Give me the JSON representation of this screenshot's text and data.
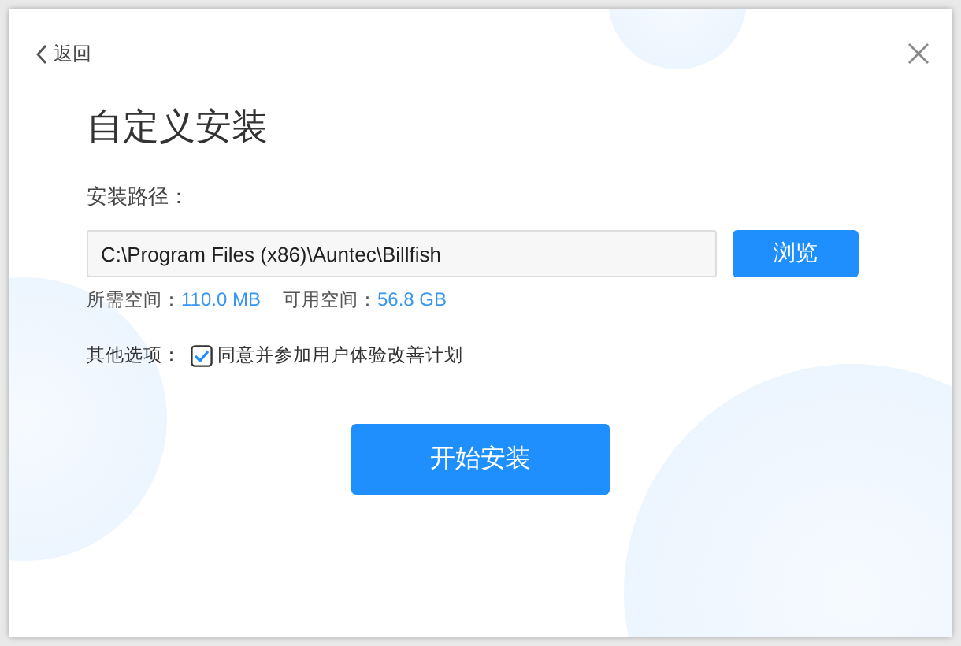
{
  "back": {
    "label": "返回"
  },
  "title": "自定义安装",
  "path": {
    "label": "安装路径：",
    "value": "C:\\Program Files (x86)\\Auntec\\Billfish"
  },
  "browse_button": "浏览",
  "space": [
    {
      "label": "所需空间：",
      "value": "110.0 MB"
    },
    {
      "label": "可用空间：",
      "value": "56.8 GB"
    }
  ],
  "options": {
    "label": "其他选项：",
    "items": [
      {
        "label": "同意并参加用户体验改善计划",
        "checked": true
      }
    ]
  },
  "start_button": "开始安装"
}
